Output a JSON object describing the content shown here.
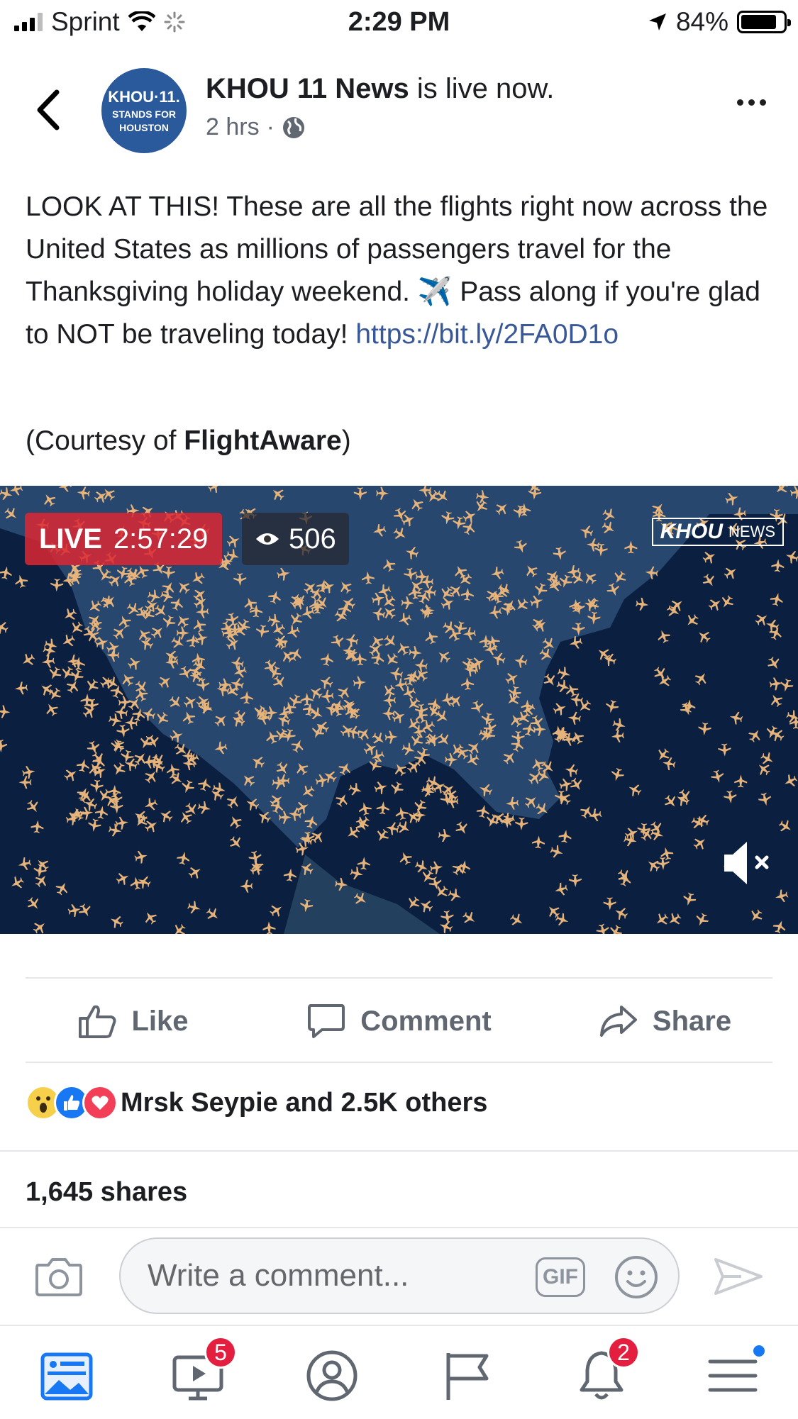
{
  "status_bar": {
    "carrier": "Sprint",
    "time": "2:29 PM",
    "battery": "84%",
    "battery_level": 0.84
  },
  "post": {
    "page_name": "KHOU 11 News",
    "status": "is live now.",
    "time_ago": "2 hrs",
    "avatar_line1": "KHOU·11.",
    "avatar_line2": "STANDS FOR",
    "avatar_line3": "HOUSTON",
    "text_part1": "LOOK AT THIS! These are all the flights right now across the United States as millions of passengers travel for the Thanksgiving holiday weekend. ✈️ Pass along if you're glad to NOT be traveling today! ",
    "link": "https://bit.ly/2FA0D1o",
    "courtesy_prefix": "(Courtesy of ",
    "courtesy_source": "FlightAware",
    "courtesy_suffix": ")"
  },
  "video": {
    "live_label": "LIVE",
    "duration": "2:57:29",
    "viewers": "506",
    "news_logo_k": "KHOU",
    "news_logo_text": "NEWS"
  },
  "actions": {
    "like": "Like",
    "comment": "Comment",
    "share": "Share"
  },
  "reactions": {
    "summary": "Mrsk Seypie and 2.5K others"
  },
  "shares": "1,645 shares",
  "composer": {
    "placeholder": "Write a comment...",
    "gif": "GIF"
  },
  "tabbar": {
    "watch_badge": "5",
    "notifications_badge": "2"
  },
  "colors": {
    "link": "#385898",
    "badge": "#e41e3f",
    "plane": "#e6b37a",
    "map_ocean": "#0b2040",
    "map_land": "#27476f"
  }
}
